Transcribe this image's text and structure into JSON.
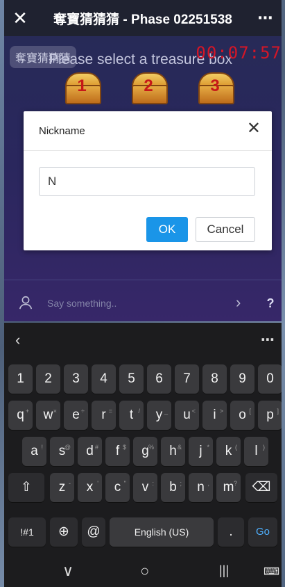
{
  "appbar": {
    "close": "✕",
    "title": "奪寶猜猜猜 - Phase 02251538",
    "more": "⋯"
  },
  "game": {
    "room_tag": "奪寶猜猜猜",
    "prompt": "Please select a treasure box",
    "timer": "00:07:57",
    "boxes": [
      "1",
      "2",
      "3"
    ],
    "chat_placeholder": "Say something..",
    "chevron": "›",
    "help": "?"
  },
  "dialog": {
    "title": "Nickname",
    "close": "✕",
    "input_value": "N",
    "ok": "OK",
    "cancel": "Cancel"
  },
  "keyboard": {
    "back": "‹",
    "more": "⋯",
    "numbers": [
      "1",
      "2",
      "3",
      "4",
      "5",
      "6",
      "7",
      "8",
      "9",
      "0"
    ],
    "row1": [
      "q",
      "w",
      "e",
      "r",
      "t",
      "y",
      "u",
      "i",
      "o",
      "p"
    ],
    "row1_hints": [
      "+",
      "×",
      "÷",
      "=",
      "/",
      "_",
      "<",
      ">",
      "[",
      "]"
    ],
    "row2": [
      "a",
      "s",
      "d",
      "f",
      "g",
      "h",
      "j",
      "k",
      "l"
    ],
    "row2_hints": [
      "!",
      "@",
      "#",
      "$",
      "%",
      "&",
      "*",
      "(",
      ")"
    ],
    "row3": [
      "z",
      "x",
      "c",
      "v",
      "b",
      "n",
      "m"
    ],
    "row3_hints": [
      "-",
      "'",
      "\"",
      ":",
      ";",
      ",",
      "?"
    ],
    "shift": "⇧",
    "backspace": "⌫",
    "symbols": "!#1",
    "globe": "⊕",
    "at": "@",
    "space": "English (US)",
    "period": ".",
    "go": "Go"
  },
  "navbar": {
    "back": "∨",
    "home": "○",
    "recent": "|||",
    "keyboard": "⌨"
  }
}
